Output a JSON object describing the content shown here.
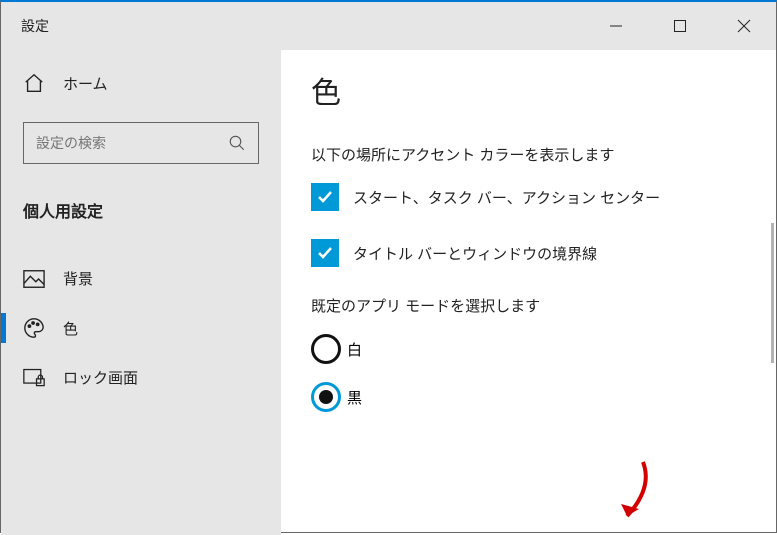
{
  "titlebar": {
    "title": "設定"
  },
  "sidebar": {
    "home": "ホーム",
    "search_placeholder": "設定の検索",
    "section": "個人用設定",
    "items": [
      {
        "label": "背景"
      },
      {
        "label": "色"
      },
      {
        "label": "ロック画面"
      }
    ]
  },
  "main": {
    "title": "色",
    "accent_heading": "以下の場所にアクセント カラーを表示します",
    "check1": "スタート、タスク バー、アクション センター",
    "check2": "タイトル バーとウィンドウの境界線",
    "mode_heading": "既定のアプリ モードを選択します",
    "radio_white": "白",
    "radio_black": "黒"
  }
}
